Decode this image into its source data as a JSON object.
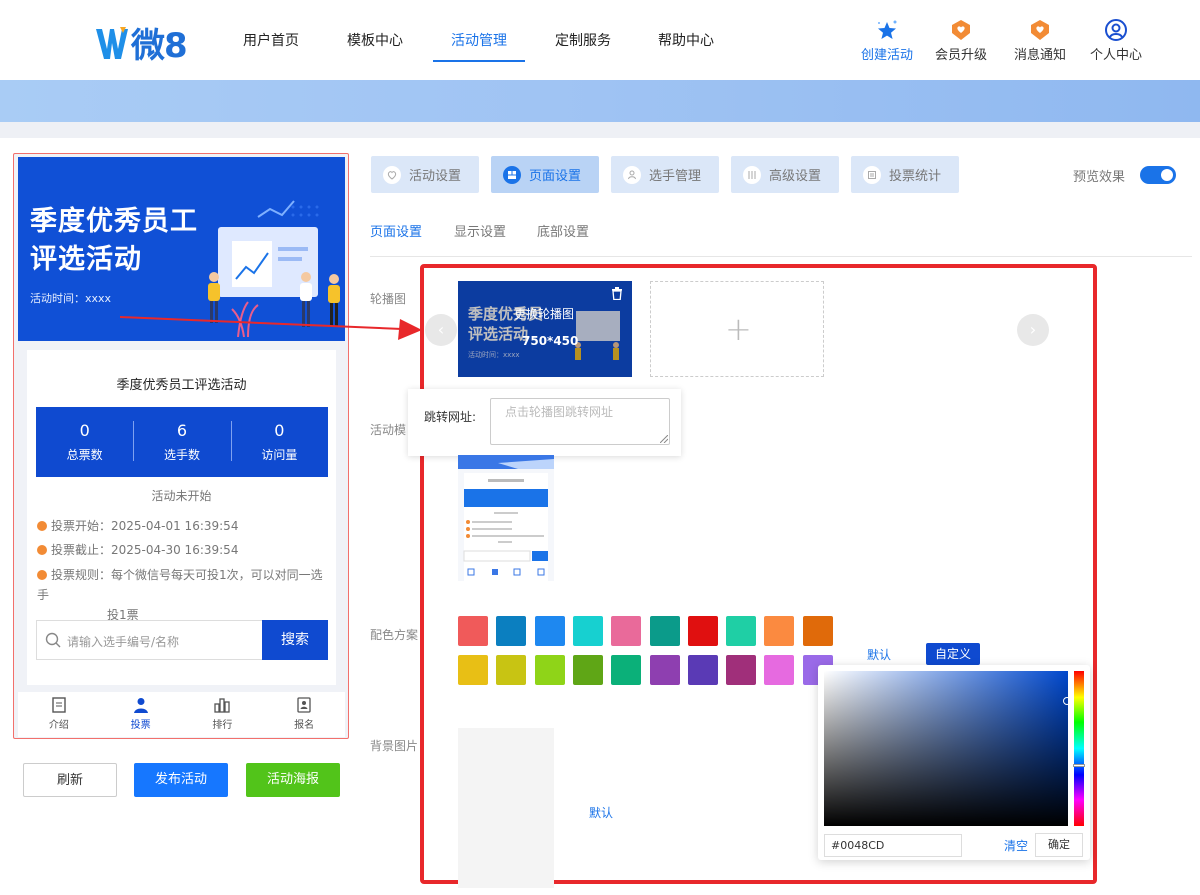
{
  "header": {
    "logo_text": "微8",
    "nav": [
      "用户首页",
      "模板中心",
      "活动管理",
      "定制服务",
      "帮助中心"
    ],
    "nav_active_index": 2,
    "icons": [
      {
        "label": "创建活动",
        "icon": "star-sparkle-icon",
        "active": true
      },
      {
        "label": "会员升级",
        "icon": "badge-heart-icon",
        "active": false
      },
      {
        "label": "消息通知",
        "icon": "badge-heart-icon",
        "active": false
      },
      {
        "label": "个人中心",
        "icon": "user-circle-icon",
        "active": false
      }
    ]
  },
  "preview": {
    "poster": {
      "title_line1": "季度优秀员工",
      "title_line2": "评选活动",
      "time": "活动时间：xxxx"
    },
    "card_title": "季度优秀员工评选活动",
    "stats": [
      {
        "value": "0",
        "label": "总票数"
      },
      {
        "value": "6",
        "label": "选手数"
      },
      {
        "value": "0",
        "label": "访问量"
      }
    ],
    "status": "活动未开始",
    "info": [
      {
        "text": "投票开始：2025-04-01 16:39:54"
      },
      {
        "text": "投票截止：2025-04-30 16:39:54"
      },
      {
        "text": "投票规则：每个微信号每天可投1次，可以对同一选手",
        "cont": "投1票"
      }
    ],
    "search_placeholder": "请输入选手编号/名称",
    "search_button": "搜索",
    "tabbar": [
      "介绍",
      "投票",
      "排行",
      "报名"
    ],
    "tabbar_active_index": 1
  },
  "actions": {
    "refresh": "刷新",
    "publish": "发布活动",
    "poster": "活动海报"
  },
  "settings": {
    "tabs": [
      "活动设置",
      "页面设置",
      "选手管理",
      "高级设置",
      "投票统计"
    ],
    "tabs_active_index": 1,
    "preview_label": "预览效果",
    "preview_on": true,
    "subtabs": [
      "页面设置",
      "显示设置",
      "底部设置"
    ],
    "subtabs_active_index": 0,
    "labels": {
      "carousel": "轮播图",
      "template": "活动模",
      "colors": "配色方案",
      "bg": "背景图片"
    },
    "carousel": {
      "thumb_title1": "季度优秀员",
      "thumb_title2": "评选活动",
      "thumb_time": "活动时间：xxxx",
      "change_label": "更换轮播图",
      "size": "750*450",
      "add": "+",
      "prev": "‹",
      "next": "›"
    },
    "jump": {
      "label": "跳转网址:",
      "placeholder": "点击轮播图跳转网址"
    },
    "colors_row1": [
      "#f05a5a",
      "#0b7fc0",
      "#1e88f0",
      "#17d0d0",
      "#e96a9a",
      "#0b9b8a",
      "#e01010",
      "#1fcfa5",
      "#fb8a40",
      "#e06a0a"
    ],
    "colors_row2": [
      "#e8bf15",
      "#c8c413",
      "#8fd418",
      "#5fa616",
      "#0bb079",
      "#8e3fb0",
      "#5a3ab5",
      "#a02f7a",
      "#e66ae0",
      "#9a6ae8"
    ],
    "color_mode": {
      "default": "默认",
      "custom": "自定义"
    },
    "picker": {
      "hex": "#0048CD",
      "clear": "清空",
      "ok": "确定"
    },
    "bg_default": "默认"
  }
}
